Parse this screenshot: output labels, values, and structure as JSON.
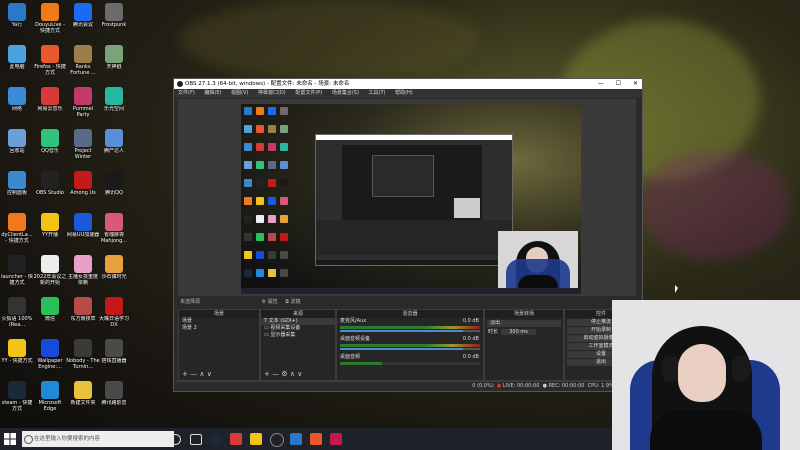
{
  "desktop_icons": [
    {
      "label": "Ya行",
      "color": "#2b77c8"
    },
    {
      "label": "DouyuLive - 快捷方式",
      "color": "#f07a1a"
    },
    {
      "label": "腾讯会议",
      "color": "#1b6bf0"
    },
    {
      "label": "Frostpunk",
      "color": "#6b6b6b"
    },
    {
      "label": "此电脑",
      "color": "#4aa3df"
    },
    {
      "label": "Firefox - 快捷方式",
      "color": "#e8582a"
    },
    {
      "label": "Ranks Fortune ...",
      "color": "#9c7e4a"
    },
    {
      "label": "天神戳",
      "color": "#7aa37a"
    },
    {
      "label": "网络",
      "color": "#3a8ad8"
    },
    {
      "label": "网易云音乐",
      "color": "#d83a3a"
    },
    {
      "label": "Pummel Party",
      "color": "#c23a6a"
    },
    {
      "label": "乐光空间",
      "color": "#27b7a0"
    },
    {
      "label": "回收站",
      "color": "#6a9fd8"
    },
    {
      "label": "QQ音乐",
      "color": "#31c27c"
    },
    {
      "label": "Project Winter",
      "color": "#5a6a8a"
    },
    {
      "label": "腾产达人",
      "color": "#5a8fd8"
    },
    {
      "label": "控制面板",
      "color": "#3b8ad0"
    },
    {
      "label": "OBS Studio",
      "color": "#222222"
    },
    {
      "label": "Among Us",
      "color": "#c51a1a"
    },
    {
      "label": "腾讯QQ",
      "color": "#1a1a1a"
    },
    {
      "label": "dyClientLa... - 快捷方式",
      "color": "#f07a1a"
    },
    {
      "label": "YY开播",
      "color": "#f2c418"
    },
    {
      "label": "网易UU加速器",
      "color": "#1a5ad8"
    },
    {
      "label": "雀魂麻将 Mahjong...",
      "color": "#d85a7a"
    },
    {
      "label": "launcher - 快捷方式",
      "color": "#222222"
    },
    {
      "label": "2022年会议之新的开始",
      "color": "#eeeeee"
    },
    {
      "label": "主播女孩重度依赖",
      "color": "#e8a0c8"
    },
    {
      "label": "沙石镇时光",
      "color": "#e8a03a"
    },
    {
      "label": "火狐语 100%(Rea...",
      "color": "#333333"
    },
    {
      "label": "微信",
      "color": "#2ac15a"
    },
    {
      "label": "东方雨夜草",
      "color": "#b84a4a"
    },
    {
      "label": "大嘴日语学习 DX",
      "color": "#c21a1a"
    },
    {
      "label": "YY - 快捷方式",
      "color": "#f2c418"
    },
    {
      "label": "Wallpaper Engine:...",
      "color": "#1a4ad8"
    },
    {
      "label": "Nobody - The Turnin...",
      "color": "#3a3a3a"
    },
    {
      "label": "搭铁直播器",
      "color": "#4a4a4a"
    },
    {
      "label": "steam - 快捷方式",
      "color": "#1b2838"
    },
    {
      "label": "Microsoft Edge",
      "color": "#1f8bd8"
    },
    {
      "label": "新建文件夹",
      "color": "#e8c03a"
    },
    {
      "label": "腾讯路影音",
      "color": "#4a4a4a"
    }
  ],
  "obs": {
    "title": "OBS 27.1.3 (64-bit, windows) - 配置文件: 未命名 - 场景: 未命名",
    "win_min": "—",
    "win_max": "☐",
    "win_close": "✕",
    "menu": [
      "文件(F)",
      "编辑(E)",
      "视图(V)",
      "停靠窗口(D)",
      "配置文件(P)",
      "场景集合(S)",
      "工具(T)",
      "帮助(H)"
    ],
    "sub_toolbar_label": "未选择源",
    "sub_toolbar_btn1": "属性",
    "sub_toolbar_btn2": "滤镜",
    "docks": {
      "scenes_title": "场景",
      "scenes": [
        "场景",
        "场景 2"
      ],
      "sources_title": "来源",
      "sources": [
        "文本 (GDI+)",
        "视频采集设备",
        "显示器采集"
      ],
      "mixer_title": "混音器",
      "mixer_rows": [
        {
          "name": "麦克风/Aux",
          "db": "0.0 dB"
        },
        {
          "name": "桌面音频设备",
          "db": "0.0 dB"
        },
        {
          "name": "桌面音频",
          "db": "0.0 dB"
        }
      ],
      "transitions_title": "场景转场",
      "transition_type": "淡出",
      "duration_label": "时长",
      "duration_value": "300 ms",
      "controls_title": "控件",
      "controls": [
        "停止推流",
        "开始录制",
        "启动虚拟摄像机",
        "工作室模式",
        "设置",
        "退出"
      ]
    },
    "status": {
      "dropped": "0 (0.0%)",
      "live_label": "LIVE:",
      "live_time": "00:00:00",
      "rec_label": "REC:",
      "rec_time": "00:00:00",
      "cpu": "CPU: 1.9%, 60.00 fps"
    }
  },
  "taskbar": {
    "search_placeholder": "在这里输入你要搜索的内容"
  }
}
